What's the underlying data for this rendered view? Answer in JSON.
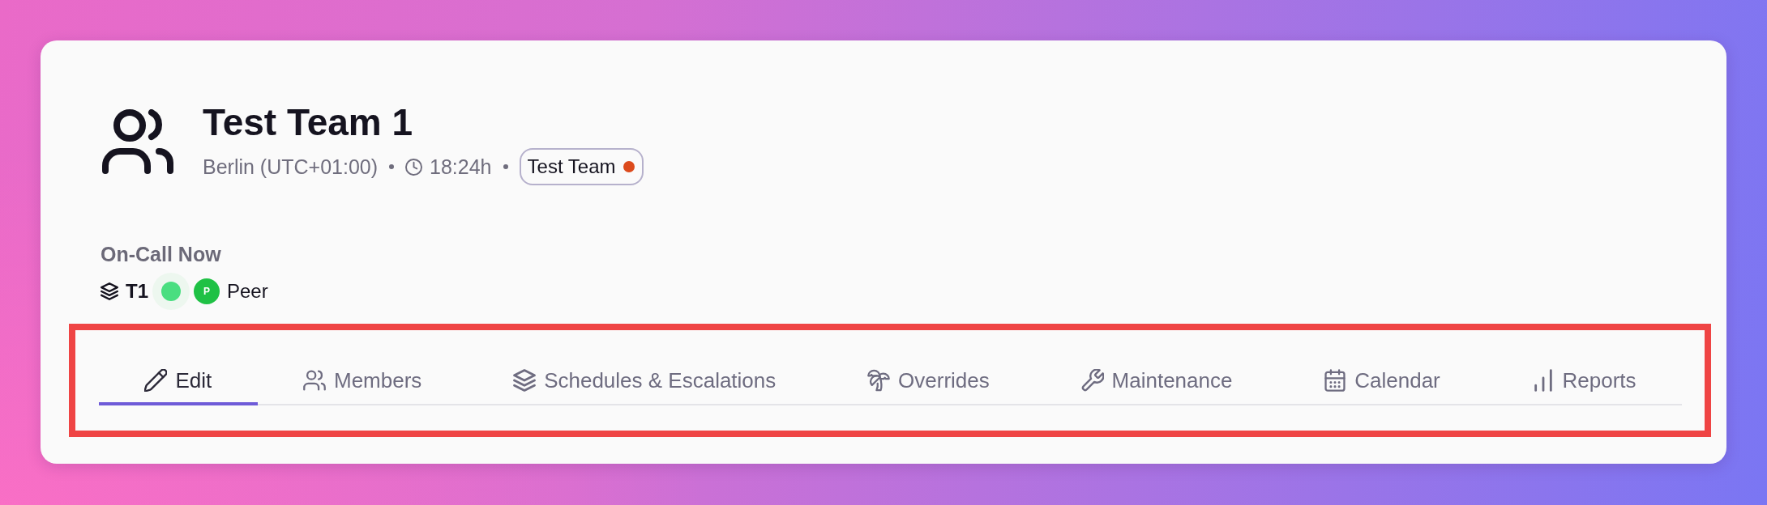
{
  "team": {
    "name": "Test Team 1",
    "location": "Berlin (UTC+01:00)",
    "local_time": "18:24h",
    "tag": {
      "label": "Test Team",
      "color": "#dc4a1c"
    }
  },
  "on_call": {
    "heading": "On-Call Now",
    "schedules": [
      {
        "label": "T1",
        "color": "#4ade80",
        "members": [
          {
            "initial": "P",
            "name": "Peer",
            "color": "#1fc145"
          }
        ]
      }
    ]
  },
  "tabs": [
    {
      "label": "Edit",
      "selected": true
    },
    {
      "label": "Members",
      "selected": false
    },
    {
      "label": "Schedules & Escalations",
      "selected": false
    },
    {
      "label": "Overrides",
      "selected": false
    },
    {
      "label": "Maintenance",
      "selected": false
    },
    {
      "label": "Calendar",
      "selected": false
    },
    {
      "label": "Reports",
      "selected": false
    }
  ]
}
